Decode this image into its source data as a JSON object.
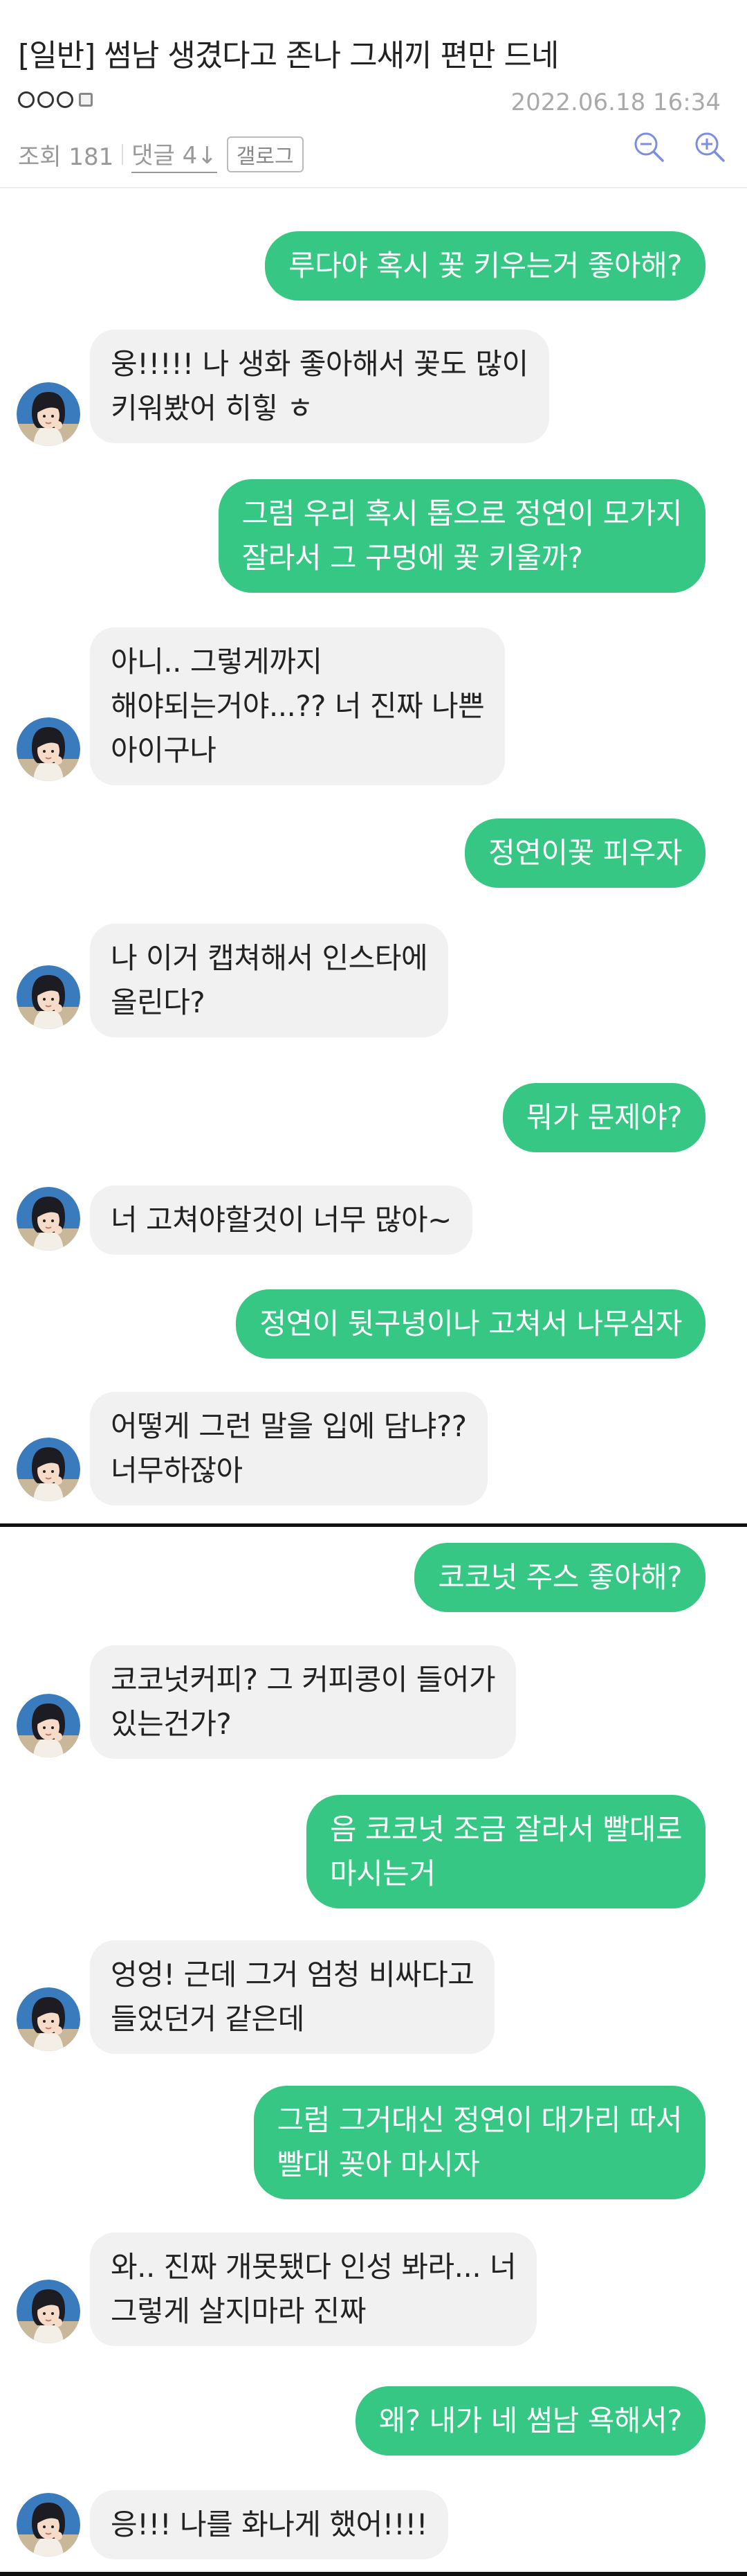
{
  "post": {
    "title": "[일반] 썸남 생겼다고 존나 그새끼 편만 드네",
    "date": "2022.06.18 16:34",
    "views": "조회 181",
    "comments": "댓글 4↓",
    "gallery": "갤로그"
  },
  "icons": {
    "zoom_out": "zoom-out-icon",
    "zoom_in": "zoom-in-icon",
    "accent": "#7b8ee0",
    "bubble_me": "#35c783",
    "bubble_other": "#f1f1f2"
  },
  "chat1": [
    {
      "from": "me",
      "text": "루다야 혹시 꽃 키우는거 좋아해?"
    },
    {
      "from": "other",
      "text": "웅!!!!! 나 생화 좋아해서 꽃도 많이\n키워봤어 히힣 ㅎ"
    },
    {
      "from": "me",
      "text": "그럼 우리 혹시 톱으로 정연이 모가지\n잘라서 그 구멍에 꽃 키울까?"
    },
    {
      "from": "other",
      "text": "아니.. 그렇게까지\n해야되는거야...?? 너 진짜 나쁜\n아이구나"
    },
    {
      "from": "me",
      "text": "정연이꽃 피우자"
    },
    {
      "from": "other",
      "text": "나 이거 캡쳐해서 인스타에\n올린다?"
    },
    {
      "from": "me",
      "text": "뭐가 문제야?"
    },
    {
      "from": "other",
      "text": "너 고쳐야할것이 너무 많아~"
    },
    {
      "from": "me",
      "text": "정연이 뒷구녕이나 고쳐서 나무심자"
    },
    {
      "from": "other",
      "text": "어떻게 그런 말을 입에 담냐??\n너무하잖아"
    }
  ],
  "chat2": [
    {
      "from": "me",
      "text": "코코넛 주스 좋아해?"
    },
    {
      "from": "other",
      "text": "코코넛커피? 그 커피콩이 들어가\n있는건가?"
    },
    {
      "from": "me",
      "text": "음 코코넛 조금 잘라서 빨대로\n마시는거"
    },
    {
      "from": "other",
      "text": "엉엉! 근데 그거 엄청 비싸다고\n들었던거 같은데"
    },
    {
      "from": "me",
      "text": "그럼 그거대신 정연이 대가리 따서\n빨대 꽂아 마시자"
    },
    {
      "from": "other",
      "text": "와.. 진짜 개못됐다 인성 봐라... 너\n그렇게 살지마라 진짜"
    },
    {
      "from": "me",
      "text": "왜? 내가 네 썸남 욕해서?"
    },
    {
      "from": "other",
      "text": "응!!! 나를 화나게 했어!!!!"
    }
  ]
}
